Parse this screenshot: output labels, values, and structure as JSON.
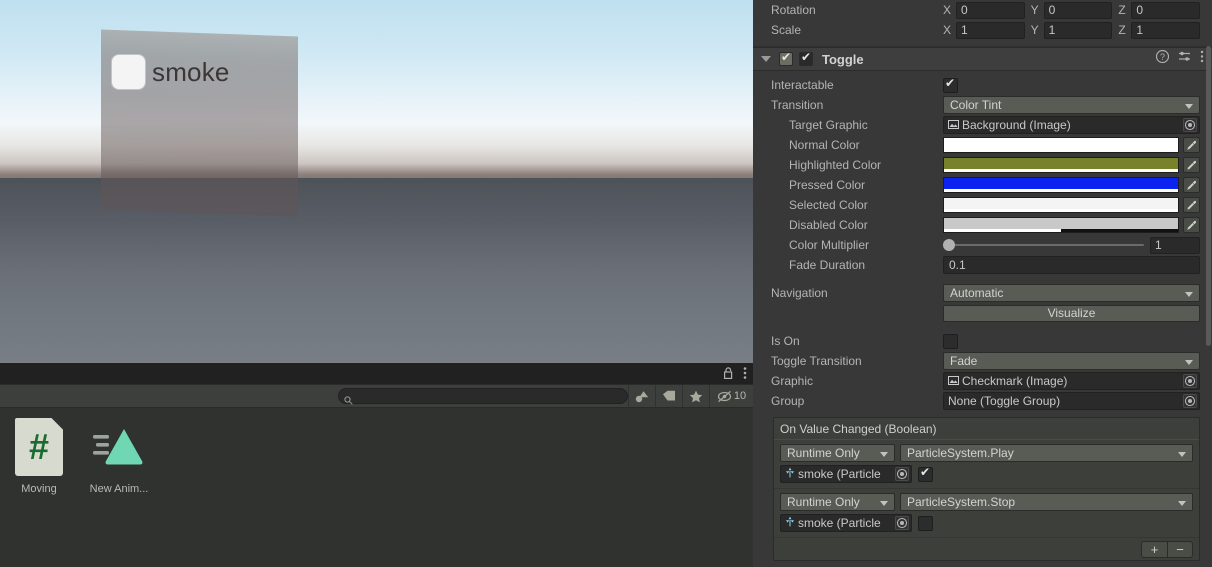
{
  "gameview": {
    "toggle_label": "smoke"
  },
  "project": {
    "tab_icons": [
      "lock-icon",
      "kebab-menu-icon"
    ],
    "search": {
      "value": "",
      "placeholder": ""
    },
    "filters": [
      "filter-by-type-icon",
      "filter-by-label-icon",
      "favorites-star-icon"
    ],
    "hidden_count": "10",
    "assets": [
      {
        "name": "Moving",
        "icon": "csharp-script-icon",
        "glyph": "#"
      },
      {
        "name": "New Anim...",
        "icon": "animation-clip-icon",
        "glyph": ""
      }
    ]
  },
  "inspector": {
    "transform": {
      "rows": [
        {
          "label": "Rotation",
          "axes": [
            {
              "name": "X",
              "value": "0"
            },
            {
              "name": "Y",
              "value": "0"
            },
            {
              "name": "Z",
              "value": "0"
            }
          ]
        },
        {
          "label": "Scale",
          "axes": [
            {
              "name": "X",
              "value": "1"
            },
            {
              "name": "Y",
              "value": "1"
            },
            {
              "name": "Z",
              "value": "1"
            }
          ]
        }
      ]
    },
    "component": {
      "title": "Toggle",
      "enabled": true,
      "header_icons": [
        "help-icon",
        "preset-icon",
        "kebab-menu-icon"
      ]
    },
    "interactable": {
      "label": "Interactable",
      "checked": true
    },
    "transition": {
      "label": "Transition",
      "value": "Color Tint"
    },
    "target_graphic": {
      "label": "Target Graphic",
      "value": "Background (Image)"
    },
    "colors": [
      {
        "label": "Normal Color",
        "hex": "#FFFFFF",
        "alpha": 100
      },
      {
        "label": "Highlighted Color",
        "hex": "#78822A",
        "alpha": 100
      },
      {
        "label": "Pressed Color",
        "hex": "#0B22F0",
        "alpha": 100
      },
      {
        "label": "Selected Color",
        "hex": "#F4F4F4",
        "alpha": 100
      },
      {
        "label": "Disabled Color",
        "hex": "#C8C8C8",
        "alpha": 50
      }
    ],
    "color_multiplier": {
      "label": "Color Multiplier",
      "value": "1",
      "percent": 0
    },
    "fade_duration": {
      "label": "Fade Duration",
      "value": "0.1"
    },
    "navigation": {
      "label": "Navigation",
      "value": "Automatic"
    },
    "visualize_button": "Visualize",
    "is_on": {
      "label": "Is On",
      "checked": false
    },
    "toggle_transition": {
      "label": "Toggle Transition",
      "value": "Fade"
    },
    "graphic": {
      "label": "Graphic",
      "value": "Checkmark (Image)"
    },
    "group": {
      "label": "Group",
      "value": "None (Toggle Group)"
    },
    "event": {
      "title": "On Value Changed (Boolean)",
      "entries": [
        {
          "mode": "Runtime Only",
          "method": "ParticleSystem.Play",
          "object": "smoke (Particle",
          "arg_checked": true
        },
        {
          "mode": "Runtime Only",
          "method": "ParticleSystem.Stop",
          "object": "smoke (Particle",
          "arg_checked": false
        }
      ],
      "add_label": "+",
      "remove_label": "−"
    }
  }
}
